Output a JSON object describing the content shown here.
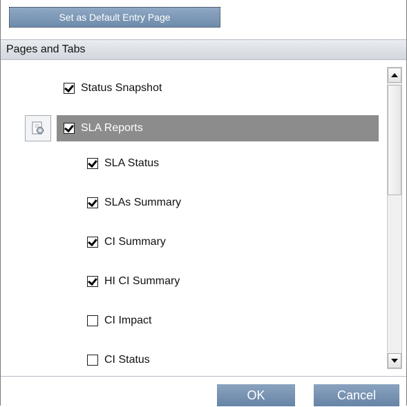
{
  "toolbar": {
    "default_button_label": "Set as Default Entry Page"
  },
  "section": {
    "title": "Pages and Tabs"
  },
  "items": [
    {
      "label": "Status Snapshot",
      "checked": true
    },
    {
      "label": "SLA Reports",
      "checked": true,
      "selected": true
    },
    {
      "label": "SLA Status",
      "checked": true
    },
    {
      "label": "SLAs Summary",
      "checked": true
    },
    {
      "label": "CI Summary",
      "checked": true
    },
    {
      "label": "HI CI Summary",
      "checked": true
    },
    {
      "label": "CI Impact",
      "checked": false
    },
    {
      "label": "CI Status",
      "checked": false
    }
  ],
  "icons": {
    "page_settings": "page-settings-icon",
    "scroll_up": "scroll-up-arrow-icon",
    "scroll_down": "scroll-down-arrow-icon"
  },
  "footer": {
    "ok_label": "OK",
    "cancel_label": "Cancel"
  },
  "colors": {
    "button": "#7895b5",
    "selected_row": "#8c8c8c",
    "header": "#dde1e7"
  }
}
